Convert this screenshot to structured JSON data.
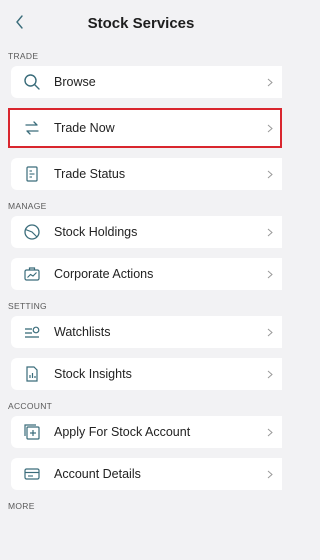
{
  "header": {
    "title": "Stock Services",
    "back_icon": "chevron-left-icon"
  },
  "colors": {
    "accent": "#3a6c7a",
    "selected_border": "#d9262e",
    "background": "#f2f2f4"
  },
  "sections": [
    {
      "label": "TRADE",
      "items": [
        {
          "label": "Browse",
          "icon": "search-icon"
        },
        {
          "label": "Trade Now",
          "icon": "swap-icon",
          "selected": true
        },
        {
          "label": "Trade Status",
          "icon": "status-doc-icon"
        }
      ]
    },
    {
      "label": "MANAGE",
      "items": [
        {
          "label": "Stock Holdings",
          "icon": "pie-icon"
        },
        {
          "label": "Corporate Actions",
          "icon": "briefcase-chart-icon"
        }
      ]
    },
    {
      "label": "SETTING",
      "items": [
        {
          "label": "Watchlists",
          "icon": "watchlist-icon"
        },
        {
          "label": "Stock Insights",
          "icon": "insights-doc-icon"
        }
      ]
    },
    {
      "label": "ACCOUNT",
      "items": [
        {
          "label": "Apply For Stock Account",
          "icon": "add-account-icon"
        },
        {
          "label": "Account Details",
          "icon": "card-icon"
        }
      ]
    },
    {
      "label": "MORE",
      "items": []
    }
  ]
}
